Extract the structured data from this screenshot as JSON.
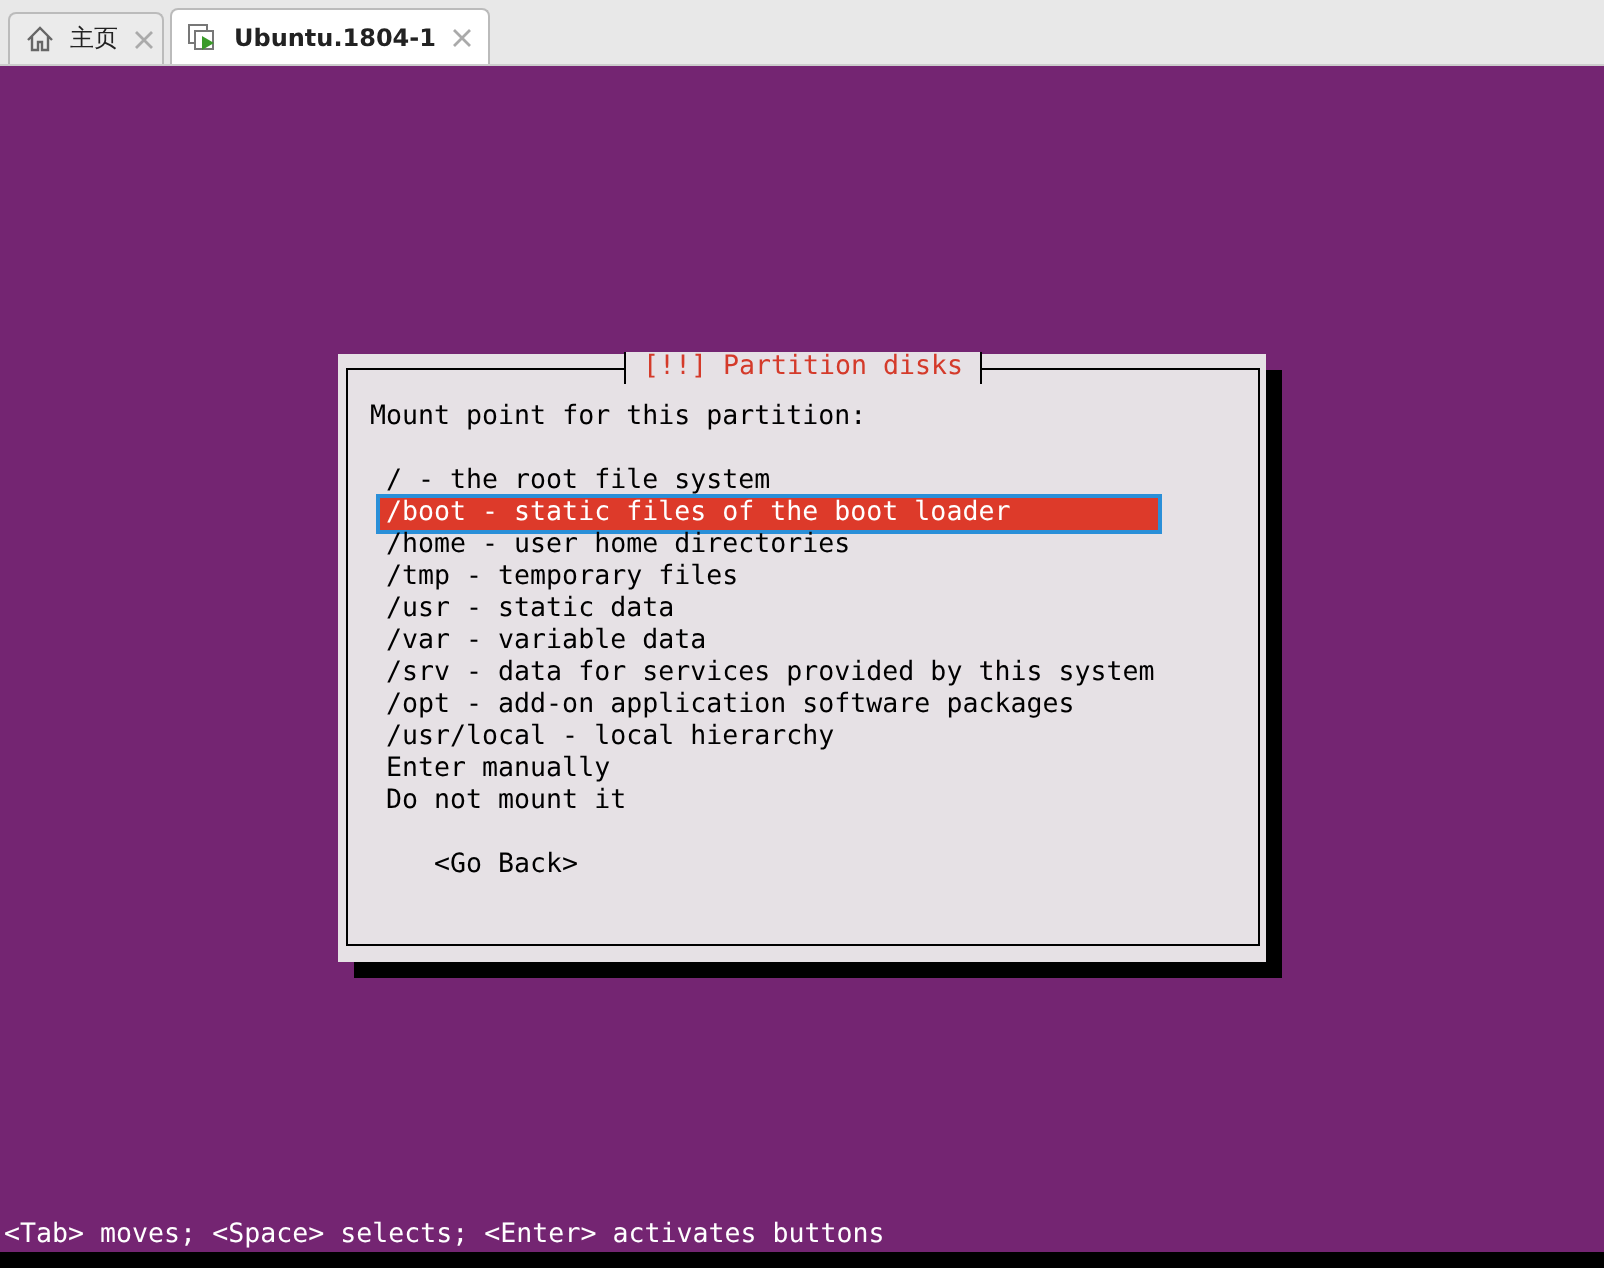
{
  "tabs": [
    {
      "label": "主页",
      "kind": "home",
      "selected": false
    },
    {
      "label": "Ubuntu.1804-1",
      "kind": "vm",
      "selected": true
    }
  ],
  "dialog": {
    "title": "[!!] Partition disks",
    "prompt": "Mount point for this partition:",
    "options": [
      {
        "label": "/ - the root file system",
        "selected": false
      },
      {
        "label": "/boot - static files of the boot loader",
        "selected": true
      },
      {
        "label": "/home - user home directories",
        "selected": false
      },
      {
        "label": "/tmp - temporary files",
        "selected": false
      },
      {
        "label": "/usr - static data",
        "selected": false
      },
      {
        "label": "/var - variable data",
        "selected": false
      },
      {
        "label": "/srv - data for services provided by this system",
        "selected": false
      },
      {
        "label": "/opt - add-on application software packages",
        "selected": false
      },
      {
        "label": "/usr/local - local hierarchy",
        "selected": false
      },
      {
        "label": "Enter manually",
        "selected": false
      },
      {
        "label": "Do not mount it",
        "selected": false
      }
    ],
    "back_button": "<Go Back>"
  },
  "status_bar": "<Tab> moves; <Space> selects; <Enter> activates buttons"
}
